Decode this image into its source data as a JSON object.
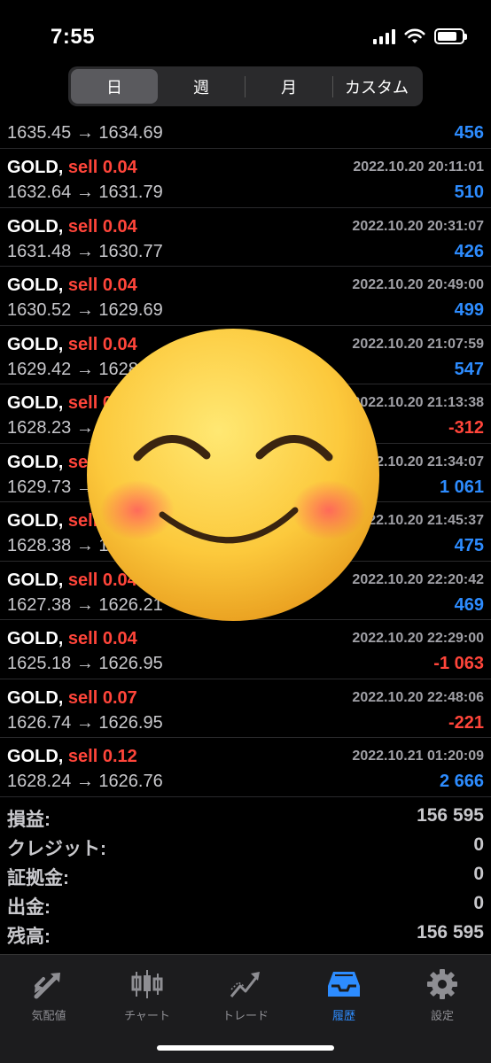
{
  "status": {
    "time": "7:55"
  },
  "segments": [
    "日",
    "週",
    "月",
    "カスタム"
  ],
  "trades": [
    {
      "prices": "1635.45 → 1634.69",
      "profit": "456",
      "sign": "pos",
      "partial": true
    },
    {
      "symbol": "GOLD,",
      "side": "sell 0.04",
      "date": "2022.10.20 20:11:01",
      "prices": "1632.64 → 1631.79",
      "profit": "510",
      "sign": "pos"
    },
    {
      "symbol": "GOLD,",
      "side": "sell 0.04",
      "date": "2022.10.20 20:31:07",
      "prices": "1631.48 → 1630.77",
      "profit": "426",
      "sign": "pos"
    },
    {
      "symbol": "GOLD,",
      "side": "sell 0.04",
      "date": "2022.10.20 20:49:00",
      "prices": "1630.52 → 1629.69",
      "profit": "499",
      "sign": "pos"
    },
    {
      "symbol": "GOLD,",
      "side": "sell 0.04",
      "date": "2022.10.20 21:07:59",
      "prices": "1629.42 → 1628.8",
      "profit": "547",
      "sign": "pos"
    },
    {
      "symbol": "GOLD,",
      "side": "sell 0.04",
      "date": "2022.10.20 21:13:38",
      "prices": "1628.23 → 1629.01",
      "profit": "-312",
      "sign": "neg"
    },
    {
      "symbol": "GOLD,",
      "side": "sell 0.04",
      "date": "2022.10.20 21:34:07",
      "prices": "1629.73 → 1627.08",
      "profit": "1 061",
      "sign": "pos"
    },
    {
      "symbol": "GOLD,",
      "side": "sell 0.04",
      "date": "2022.10.20 21:45:37",
      "prices": "1628.38 → 1627.19",
      "profit": "475",
      "sign": "pos"
    },
    {
      "symbol": "GOLD,",
      "side": "sell 0.04",
      "date": "2022.10.20 22:20:42",
      "prices": "1627.38 → 1626.21",
      "profit": "469",
      "sign": "pos"
    },
    {
      "symbol": "GOLD,",
      "side": "sell 0.04",
      "date": "2022.10.20 22:29:00",
      "prices": "1625.18 → 1626.95",
      "profit": "-1 063",
      "sign": "neg"
    },
    {
      "symbol": "GOLD,",
      "side": "sell 0.07",
      "date": "2022.10.20 22:48:06",
      "prices": "1626.74 → 1626.95",
      "profit": "-221",
      "sign": "neg"
    },
    {
      "symbol": "GOLD,",
      "side": "sell 0.12",
      "date": "2022.10.21 01:20:09",
      "prices": "1628.24 → 1626.76",
      "profit": "2 666",
      "sign": "pos"
    }
  ],
  "summary": [
    {
      "label": "損益:",
      "value": "156 595"
    },
    {
      "label": "クレジット:",
      "value": "0"
    },
    {
      "label": "証拠金:",
      "value": "0"
    },
    {
      "label": "出金:",
      "value": "0"
    },
    {
      "label": "残高:",
      "value": "156 595"
    }
  ],
  "tabs": [
    {
      "label": "気配値",
      "icon": "quotes-arrows-icon"
    },
    {
      "label": "チャート",
      "icon": "candlestick-chart-icon"
    },
    {
      "label": "トレード",
      "icon": "trade-line-icon"
    },
    {
      "label": "履歴",
      "icon": "history-inbox-icon",
      "active": true
    },
    {
      "label": "設定",
      "icon": "settings-gear-icon"
    }
  ],
  "colors": {
    "profit_positive": "#2d8cff",
    "profit_negative": "#ff453a",
    "active_tab": "#2d8cff",
    "sell": "#ff453a"
  }
}
